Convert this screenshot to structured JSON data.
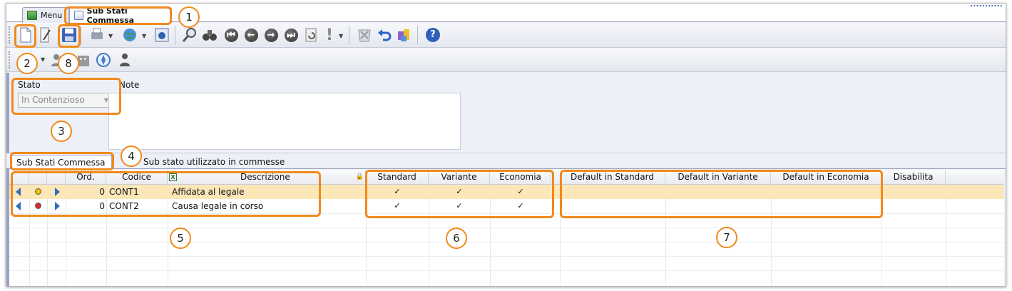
{
  "tabs": {
    "menu": "Menu",
    "active": "Sub Stati Commessa"
  },
  "brand_fragment": "...........",
  "form": {
    "stato_label": "Stato",
    "stato_value": "In Contenzioso",
    "note_label": "Note"
  },
  "subtabs": [
    "Sub Stati Commessa",
    "Sub stato utilizzato in commesse"
  ],
  "grid": {
    "headers": {
      "ord": "Ord.",
      "codice": "Codice",
      "descrizione": "Descrizione",
      "standard": "Standard",
      "variante": "Variante",
      "economia": "Economia",
      "def_standard": "Default in Standard",
      "def_variante": "Default in Variante",
      "def_economia": "Default in Economia",
      "disabilita": "Disabilita"
    },
    "rows": [
      {
        "ord": "0",
        "codice": "CONT1",
        "descrizione": "Affidata al legale",
        "standard": "✓",
        "variante": "✓",
        "economia": "✓",
        "dot_color": "#f2c200"
      },
      {
        "ord": "0",
        "codice": "CONT2",
        "descrizione": "Causa legale in corso",
        "standard": "✓",
        "variante": "✓",
        "economia": "✓",
        "dot_color": "#d0312d"
      }
    ]
  },
  "callouts": [
    "1",
    "2",
    "3",
    "4",
    "5",
    "6",
    "7",
    "8"
  ],
  "colors": {
    "callout": "#f08a1c",
    "selected_row": "#fce7b8",
    "nav_arrow": "#2f6fc1"
  }
}
